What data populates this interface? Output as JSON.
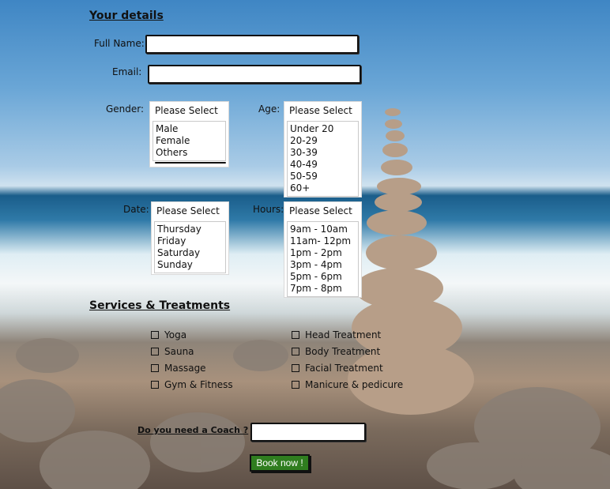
{
  "your_details": {
    "heading": "Your details",
    "full_name_label": "Full Name:",
    "email_label": "Email:"
  },
  "gender": {
    "label": "Gender:",
    "selected": "Please Select",
    "options": [
      "Male",
      "Female",
      "Others"
    ]
  },
  "age": {
    "label": "Age:",
    "selected": "Please Select",
    "options": [
      "Under 20",
      "20-29",
      "30-39",
      "40-49",
      "50-59",
      "60+"
    ]
  },
  "date": {
    "label": "Date:",
    "selected": "Please Select",
    "options": [
      "Thursday",
      "Friday",
      "Saturday",
      "Sunday"
    ]
  },
  "hours": {
    "label": "Hours:",
    "selected": "Please Select",
    "options": [
      "9am - 10am",
      "11am- 12pm",
      "1pm - 2pm",
      "3pm - 4pm",
      "5pm - 6pm",
      "7pm - 8pm"
    ]
  },
  "services": {
    "heading": "Services & Treatments",
    "left": [
      "Yoga",
      "Sauna",
      "Massage",
      "Gym & Fitness"
    ],
    "right": [
      "Head Treatment",
      "Body Treatment",
      "Facial Treatment",
      "Manicure & pedicure"
    ]
  },
  "coach": {
    "label": "Do you need a Coach ?"
  },
  "book_button": "Book now !"
}
